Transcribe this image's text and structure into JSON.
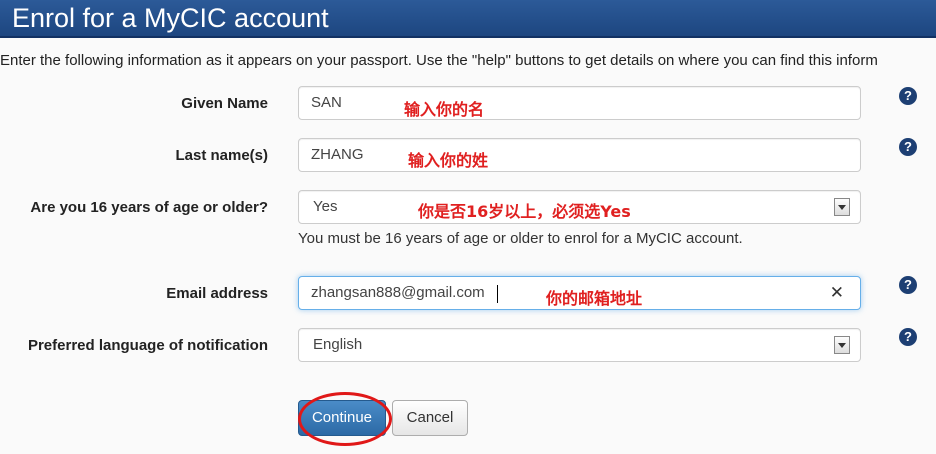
{
  "header": {
    "title": "Enrol for a MyCIC account"
  },
  "intro": "Enter the following information as it appears on your passport. Use the \"help\" buttons to get details on where you can find this inform",
  "form": {
    "given_name": {
      "label": "Given Name",
      "value": "SAN",
      "annotation": "输入你的名"
    },
    "last_name": {
      "label": "Last name(s)",
      "value": "ZHANG",
      "annotation": "输入你的姓"
    },
    "age": {
      "label": "Are you 16 years of age or older?",
      "value": "Yes",
      "annotation": "你是否16岁以上，必须选Yes",
      "note": "You must be 16 years of age or older to enrol for a MyCIC account."
    },
    "email": {
      "label": "Email address",
      "value": "zhangsan888@gmail.com",
      "annotation": "你的邮箱地址"
    },
    "language": {
      "label": "Preferred language of notification",
      "value": "English"
    }
  },
  "help_glyph": "?",
  "clear_glyph": "✕",
  "buttons": {
    "continue": "Continue",
    "cancel": "Cancel"
  },
  "colors": {
    "header": "#1d4680",
    "annotation": "#e02020",
    "primary": "#2c6aa6",
    "help": "#1d3f73"
  }
}
